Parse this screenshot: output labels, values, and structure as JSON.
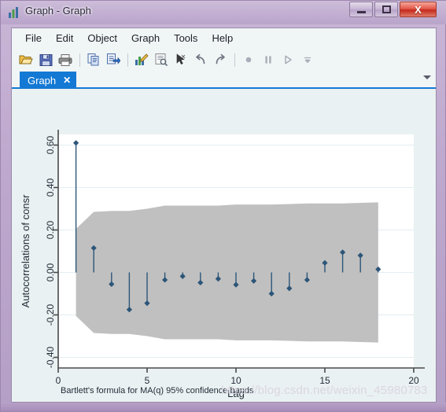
{
  "window": {
    "title": "Graph - Graph",
    "icon": "bar-chart-icon",
    "buttons": {
      "minimize": "Minimize",
      "maximize": "Maximize",
      "close": "X"
    }
  },
  "menu": {
    "items": [
      {
        "label": "File"
      },
      {
        "label": "Edit"
      },
      {
        "label": "Object"
      },
      {
        "label": "Graph"
      },
      {
        "label": "Tools"
      },
      {
        "label": "Help"
      }
    ]
  },
  "toolbar": {
    "buttons": [
      {
        "name": "open-icon",
        "title": "Open"
      },
      {
        "name": "save-icon",
        "title": "Save"
      },
      {
        "name": "print-icon",
        "title": "Print"
      },
      {
        "name": "copy-icon",
        "title": "Copy"
      },
      {
        "name": "paste-icon",
        "title": "Paste"
      },
      {
        "name": "edit-graph-icon",
        "title": "Start Graph Editor"
      },
      {
        "name": "preview-icon",
        "title": "Preview"
      },
      {
        "name": "pointer-icon",
        "title": "Pointer Tool"
      },
      {
        "name": "undo-icon",
        "title": "Undo"
      },
      {
        "name": "redo-icon",
        "title": "Redo"
      },
      {
        "name": "record-icon",
        "title": "Record"
      },
      {
        "name": "pause-icon",
        "title": "Pause"
      },
      {
        "name": "play-icon",
        "title": "Play"
      },
      {
        "name": "more-icon",
        "title": "More"
      }
    ]
  },
  "tabs": [
    {
      "label": "Graph",
      "close": "✕",
      "active": true
    }
  ],
  "watermark": "https://blog.csdn.net/weixin_45980783",
  "chart_data": {
    "type": "bar",
    "title": "",
    "xlabel": "Lag",
    "ylabel": "Autocorrelations of consr",
    "note": "Bartlett's formula for MA(q) 95% confidence bands",
    "xlim": [
      0,
      20
    ],
    "ylim": [
      -0.45,
      0.65
    ],
    "xticks": [
      0,
      5,
      10,
      15,
      20
    ],
    "yticks": [
      -0.4,
      -0.2,
      0.0,
      0.2,
      0.4,
      0.6
    ],
    "ytick_labels": [
      "-0.40",
      "-0.20",
      "0.00",
      "0.20",
      "0.40",
      "0.60"
    ],
    "xtick_labels": [
      "0",
      "5",
      "10",
      "15",
      "20"
    ],
    "grid": true,
    "series_color": "#2c5578",
    "band_color": "#c0c0c0",
    "categories": [
      1,
      2,
      3,
      4,
      5,
      6,
      7,
      8,
      9,
      10,
      11,
      12,
      13,
      14,
      15,
      16,
      17,
      18
    ],
    "values": [
      0.61,
      0.115,
      -0.055,
      -0.175,
      -0.145,
      -0.035,
      -0.018,
      -0.048,
      -0.03,
      -0.058,
      -0.04,
      -0.1,
      -0.075,
      -0.035,
      0.045,
      0.095,
      0.08,
      0.015
    ],
    "confidence_band_upper": [
      0.205,
      0.285,
      0.29,
      0.29,
      0.3,
      0.315,
      0.315,
      0.315,
      0.315,
      0.32,
      0.32,
      0.32,
      0.322,
      0.325,
      0.325,
      0.325,
      0.328,
      0.33
    ],
    "confidence_band_lower": [
      -0.205,
      -0.285,
      -0.29,
      -0.29,
      -0.3,
      -0.315,
      -0.315,
      -0.315,
      -0.315,
      -0.32,
      -0.32,
      -0.32,
      -0.322,
      -0.325,
      -0.325,
      -0.325,
      -0.328,
      -0.33
    ],
    "legend": []
  }
}
